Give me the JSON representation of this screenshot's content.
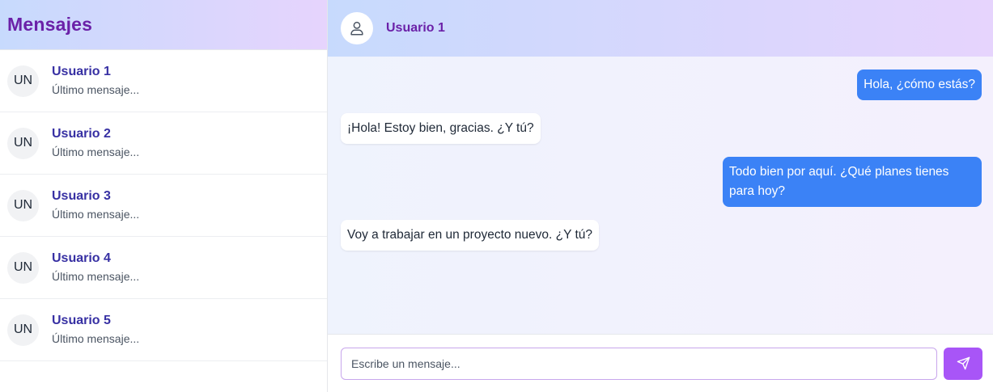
{
  "sidebar": {
    "title": "Mensajes",
    "contacts": [
      {
        "initials": "UN",
        "name": "Usuario 1",
        "preview": "Último mensaje..."
      },
      {
        "initials": "UN",
        "name": "Usuario 2",
        "preview": "Último mensaje..."
      },
      {
        "initials": "UN",
        "name": "Usuario 3",
        "preview": "Último mensaje..."
      },
      {
        "initials": "UN",
        "name": "Usuario 4",
        "preview": "Último mensaje..."
      },
      {
        "initials": "UN",
        "name": "Usuario 5",
        "preview": "Último mensaje..."
      }
    ]
  },
  "chat": {
    "header": {
      "name": "Usuario 1",
      "avatar_icon": "user-icon"
    },
    "messages": [
      {
        "side": "sent",
        "text": "Hola, ¿cómo estás?"
      },
      {
        "side": "recv",
        "text": "¡Hola! Estoy bien, gracias. ¿Y tú?"
      },
      {
        "side": "sent",
        "text": "Todo bien por aquí. ¿Qué planes tienes para hoy?"
      },
      {
        "side": "recv",
        "text": "Voy a trabajar en un proyecto nuevo. ¿Y tú?"
      }
    ],
    "composer": {
      "placeholder": "Escribe un mensaje...",
      "value": "",
      "send_icon": "send-icon"
    }
  },
  "colors": {
    "accent_purple": "#6b21a8",
    "send_button": "#a855f7",
    "sent_bubble": "#3b82f6",
    "contact_name": "#3730a3"
  }
}
